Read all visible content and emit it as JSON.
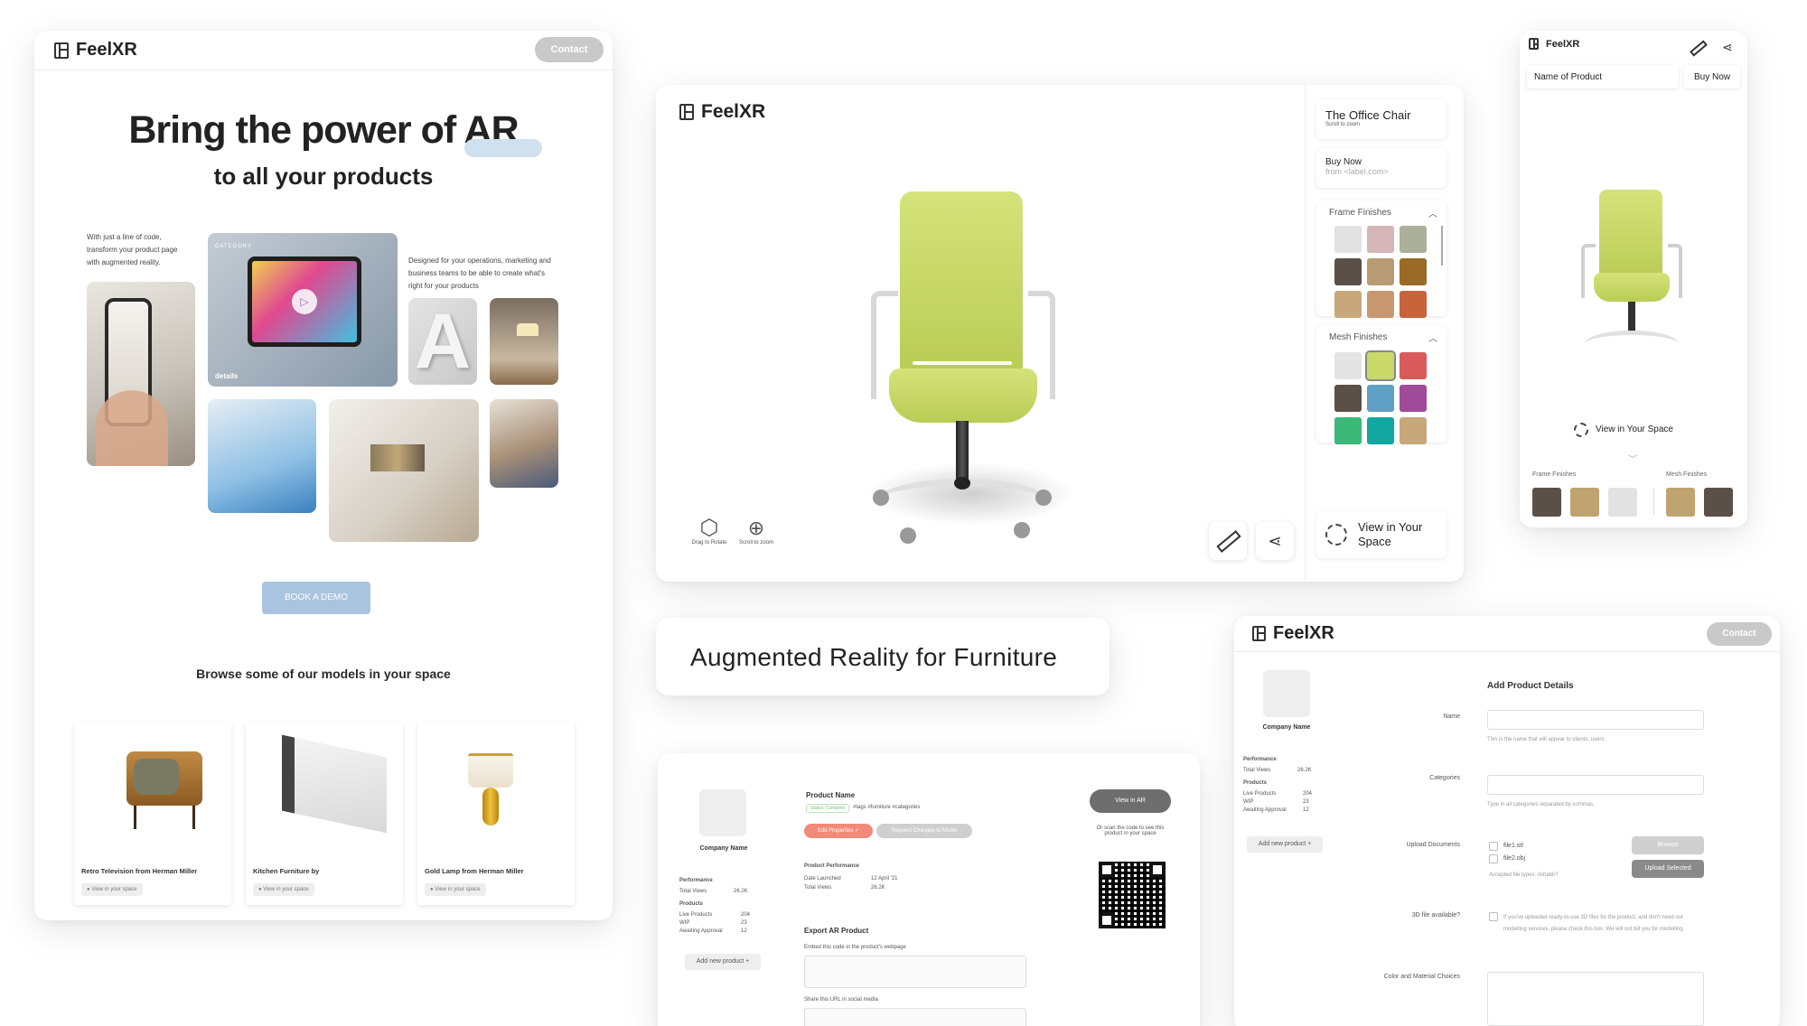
{
  "landing": {
    "logo": "FeelXR",
    "contact": "Contact",
    "hero_title_1": "Bring the power of AR",
    "hero_title_2": "to all your products",
    "left_copy": "With just a line of code, transform your product page with augmented reality.",
    "right_copy": "Designed for your operations, marketing and business teams to be able to create what's right for your products",
    "tablet_tag": "CATEGORY",
    "tablet_details": "details",
    "book_demo": "BOOK A DEMO",
    "browse_title": "Browse some of our models in your space",
    "products": [
      {
        "name": "Retro Television from Herman Miller",
        "cta": "View in your space"
      },
      {
        "name": "Kitchen Furniture by",
        "cta": "View in your space"
      },
      {
        "name": "Gold Lamp from Herman Miller",
        "cta": "View in your space"
      }
    ]
  },
  "viewer": {
    "logo": "FeelXR",
    "product_title": "The Office Chair",
    "product_sub": "Scroll to zoom",
    "buy_now": "Buy Now",
    "buy_from": "from <label.com>",
    "frame_finishes": "Frame Finishes",
    "mesh_finishes": "Mesh Finishes",
    "drag_rotate": "Drag to Rotate",
    "scroll_zoom": "Scroll to zoom",
    "view_in_space": "View in Your Space",
    "frame_colors": [
      "#e2e2e2",
      "#d4b5b8",
      "#aab09a",
      "#5a5048",
      "#b89a74",
      "#9a6a28",
      "#c8a87a",
      "#c89870",
      "#c8643c"
    ],
    "mesh_colors": [
      "#e4e4e4",
      "#c9d96a",
      "#d95a5a",
      "#5a5048",
      "#5fa0c4",
      "#a04a9a",
      "#3cb878",
      "#10a8a0",
      "#c8a87a"
    ]
  },
  "mobile": {
    "logo": "FeelXR",
    "name_label": "Name of Product",
    "buy_now": "Buy Now",
    "view_in_space": "View in Your Space",
    "frame_label": "Frame Finishes",
    "mesh_label": "Mesh Finishes",
    "frame_colors": [
      "#5a5048",
      "#c0a470",
      "#e2e2e2"
    ],
    "mesh_colors": [
      "#c0a470",
      "#5a5048"
    ]
  },
  "tagline": "Augmented Reality for Furniture",
  "dashboard": {
    "company": "Company Name",
    "performance": "Performance",
    "total_views_label": "Total Views",
    "total_views": "26.2K",
    "products_label": "Products",
    "live_label": "Live Products",
    "live": "204",
    "wip_label": "WIP",
    "wip": "23",
    "awaiting_label": "Awaiting Approval",
    "awaiting": "12",
    "add_product": "Add new product +",
    "product_name": "Product Name",
    "status": "Status: Complete",
    "tags": "#tags #furniture #categories",
    "edit_props": "Edit Properties ✓",
    "request_changes": "Request Changes to Model",
    "perf_title": "Product Performance",
    "date_label": "Date Launched",
    "date": "12 April '21",
    "views_label": "Total Views",
    "views": "26.2K",
    "export_title": "Export AR Product",
    "embed_label": "Embed this code in the product's webpage",
    "share_label": "Share this URL in social media",
    "view_ar": "View in AR",
    "scan_text": "Or scan the code to see this product in your space"
  },
  "admin": {
    "logo": "FeelXR",
    "contact": "Contact",
    "company": "Company Name",
    "performance": "Performance",
    "total_views_label": "Total Views",
    "total_views": "26.2K",
    "products_label": "Products",
    "live_label": "Live Products",
    "live": "204",
    "wip_label": "WIP",
    "wip": "23",
    "awaiting_label": "Awaiting Approval",
    "awaiting": "12",
    "add_product": "Add new product +",
    "form_title": "Add Product Details",
    "name_label": "Name",
    "name_hint": "This is the name that will appear to clients, users.",
    "categories_label": "Categories",
    "categories_hint": "Type in all categories separated by commas.",
    "upload_label": "Upload Documents",
    "file1": "file1.stl",
    "file2": "file2.obj",
    "browse": "Browse",
    "upload_selected": "Upload Selected",
    "accepted": "Accepted file types: rlshabh?",
    "file_avail_label": "3D file available?",
    "file_avail_text": "If you've uploaded ready-to-use 3D files for the product, and don't need our modelling services, please check this box. We will not bill you for modelling.",
    "color_label": "Color and Material Choices"
  }
}
